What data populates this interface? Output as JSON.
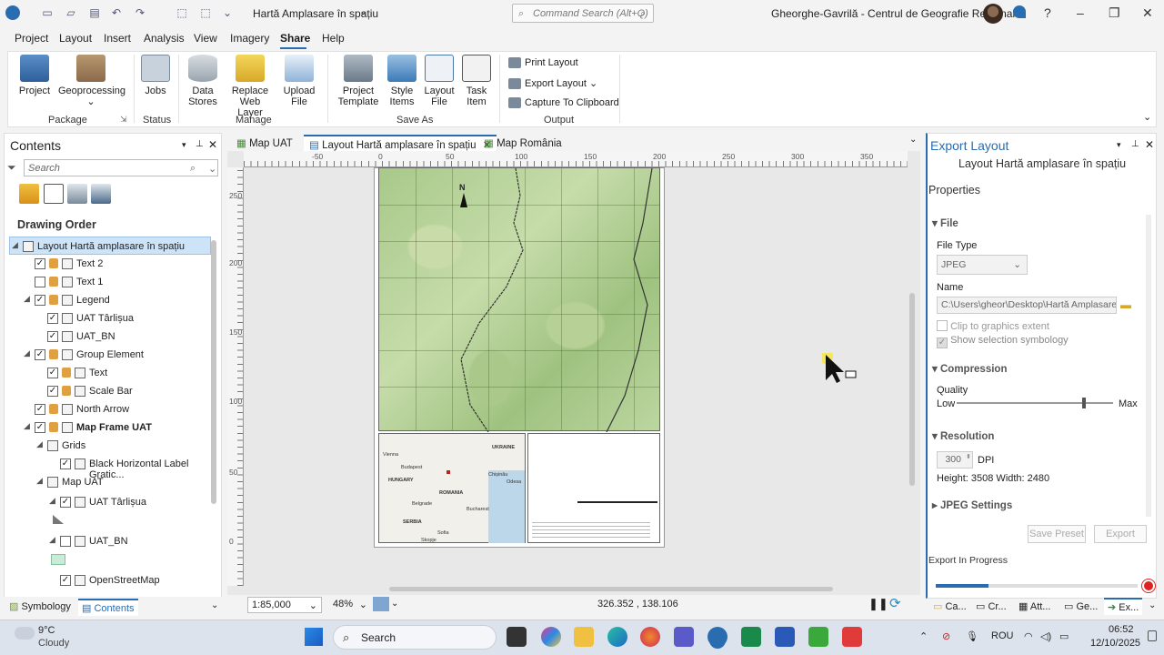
{
  "titlebar": {
    "title": "Hartă Amplasare în spațiu",
    "command_search_placeholder": "Command Search (Alt+Q)",
    "user": "Gheorghe-Gavrilă - Centrul de Geografie Regională"
  },
  "menu": [
    "Project",
    "Layout",
    "Insert",
    "Analysis",
    "View",
    "Imagery",
    "Share",
    "Help"
  ],
  "menu_active": "Share",
  "ribbon": {
    "package": {
      "label": "Package",
      "buttons": [
        "Project",
        "Geoprocessing"
      ]
    },
    "status": {
      "label": "Status",
      "buttons": [
        "Jobs"
      ]
    },
    "manage": {
      "label": "Manage",
      "buttons": [
        "Data Stores",
        "Replace Web Layer",
        "Upload File"
      ]
    },
    "save_as": {
      "label": "Save As",
      "buttons": [
        "Project Template",
        "Style Items",
        "Layout File",
        "Task Item"
      ]
    },
    "output": {
      "label": "Output",
      "buttons": [
        "Print Layout",
        "Export Layout",
        "Capture To Clipboard"
      ]
    }
  },
  "contents": {
    "title": "Contents",
    "search_placeholder": "Search",
    "section": "Drawing Order",
    "items": [
      {
        "label": "Layout Hartă amplasare în spațiu",
        "checked": null,
        "indent": 0,
        "selected": true
      },
      {
        "label": "Text 2",
        "checked": true,
        "indent": 1
      },
      {
        "label": "Text 1",
        "checked": false,
        "indent": 1
      },
      {
        "label": "Legend",
        "checked": true,
        "indent": 1
      },
      {
        "label": "UAT Târlișua",
        "checked": true,
        "indent": 2
      },
      {
        "label": "UAT_BN",
        "checked": true,
        "indent": 2
      },
      {
        "label": "Group Element",
        "checked": true,
        "indent": 1
      },
      {
        "label": "Text",
        "checked": true,
        "indent": 2
      },
      {
        "label": "Scale Bar",
        "checked": true,
        "indent": 2
      },
      {
        "label": "North Arrow",
        "checked": true,
        "indent": 1
      },
      {
        "label": "Map Frame UAT",
        "checked": true,
        "indent": 1,
        "bold": true
      },
      {
        "label": "Grids",
        "checked": null,
        "indent": 2
      },
      {
        "label": "Black Horizontal Label Gratic...",
        "checked": true,
        "indent": 3
      },
      {
        "label": "Map UAT",
        "checked": null,
        "indent": 2
      },
      {
        "label": "UAT Târlișua",
        "checked": true,
        "indent": 3
      },
      {
        "label": "UAT_BN",
        "checked": false,
        "indent": 3
      },
      {
        "label": "OpenStreetMap",
        "checked": true,
        "indent": 3
      }
    ],
    "bottom_tabs": [
      "Symbology",
      "Contents"
    ]
  },
  "doc_tabs": [
    "Map UAT",
    "Layout Hartă amplasare în spațiu",
    "Map România"
  ],
  "active_doc_tab": "Layout Hartă amplasare în spațiu",
  "ruler": {
    "h_labels": [
      "-50",
      "0",
      "50",
      "100",
      "150",
      "200",
      "250",
      "300",
      "350"
    ],
    "v_labels": [
      "250",
      "200",
      "150",
      "100",
      "50",
      "0"
    ]
  },
  "layout_map": {
    "north_label": "N",
    "inset_labels": [
      "UKRAINE",
      "Budapest",
      "HUNGARY",
      "ROMANIA",
      "Chișinău",
      "Odesa",
      "Belgrade",
      "Bucharest",
      "SERBIA",
      "Sofia",
      "Skopje",
      "Vienna"
    ]
  },
  "statusbar": {
    "scale": "1:85,000",
    "zoom": "48%",
    "coords": "326.352 , 138.106"
  },
  "export_panel": {
    "title": "Export Layout",
    "subtitle": "Layout Hartă amplasare în spațiu",
    "properties": "Properties",
    "file_section": "File",
    "file_type_label": "File Type",
    "file_type_value": "JPEG",
    "name_label": "Name",
    "name_value": "C:\\Users\\gheor\\Desktop\\Hartă Amplasare în",
    "clip_label": "Clip to graphics extent",
    "show_sel_label": "Show selection symbology",
    "compression_section": "Compression",
    "quality_label": "Quality",
    "quality_low": "Low",
    "quality_max": "Max",
    "quality_value": 0.8,
    "resolution_section": "Resolution",
    "dpi_value": "300",
    "dpi_unit": "DPI",
    "dims": "Height: 3508 Width: 2480",
    "jpeg_settings": "JPEG Settings",
    "save_preset": "Save Preset",
    "export_btn": "Export",
    "progress_label": "Export In Progress",
    "progress_value": 0.26
  },
  "bottom_panel_tabs": [
    "Ca...",
    "Cr...",
    "Att...",
    "Ge...",
    "Ex..."
  ],
  "taskbar": {
    "weather_temp": "9°C",
    "weather_desc": "Cloudy",
    "search": "Search",
    "lang": "ROU",
    "time": "06:52",
    "date": "12/10/2025"
  }
}
